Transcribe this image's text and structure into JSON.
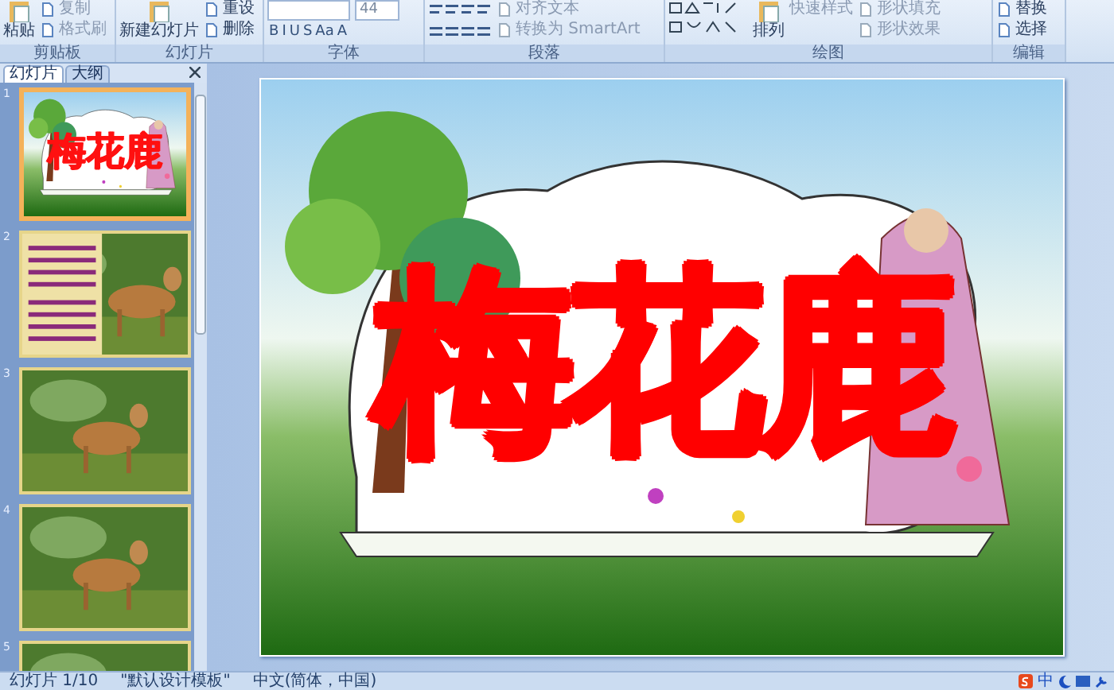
{
  "ribbon": {
    "groups": [
      {
        "kind": "clipboard",
        "label": "剪贴板",
        "large": "粘贴",
        "small": [
          "复制",
          "格式刷"
        ]
      },
      {
        "kind": "slides",
        "label": "幻灯片",
        "large": "新建幻灯片",
        "small": [
          "重设",
          "删除"
        ]
      },
      {
        "kind": "font",
        "label": "字体",
        "size": "44",
        "buttons": [
          "B",
          "I",
          "U",
          "S",
          "Aa",
          "A"
        ]
      },
      {
        "kind": "paragraph",
        "label": "段落",
        "small": [
          "对齐文本",
          "转换为 SmartArt"
        ]
      },
      {
        "kind": "drawing",
        "label": "绘图",
        "large": "排列",
        "middle": "快速样式",
        "small": [
          "形状填充",
          "形状效果"
        ]
      },
      {
        "kind": "editing",
        "label": "编辑",
        "small": [
          "替换",
          "选择"
        ]
      }
    ]
  },
  "panel": {
    "tabs": [
      {
        "label": "幻灯片",
        "selected": true
      },
      {
        "label": "大纲",
        "selected": false
      }
    ],
    "slides": [
      {
        "number": "1",
        "kind": "title",
        "title": "梅花鹿",
        "selected": true
      },
      {
        "number": "2",
        "kind": "text-photo",
        "selected": false
      },
      {
        "number": "3",
        "selected": false
      },
      {
        "number": "4",
        "selected": false
      },
      {
        "number": "5",
        "selected": false
      }
    ]
  },
  "slide": {
    "title": "梅花鹿"
  },
  "status_bar": {
    "items": [
      "幻灯片 1/10",
      "\"默认设计模板\"",
      "中文(简体，中国)"
    ],
    "ime": "中"
  }
}
